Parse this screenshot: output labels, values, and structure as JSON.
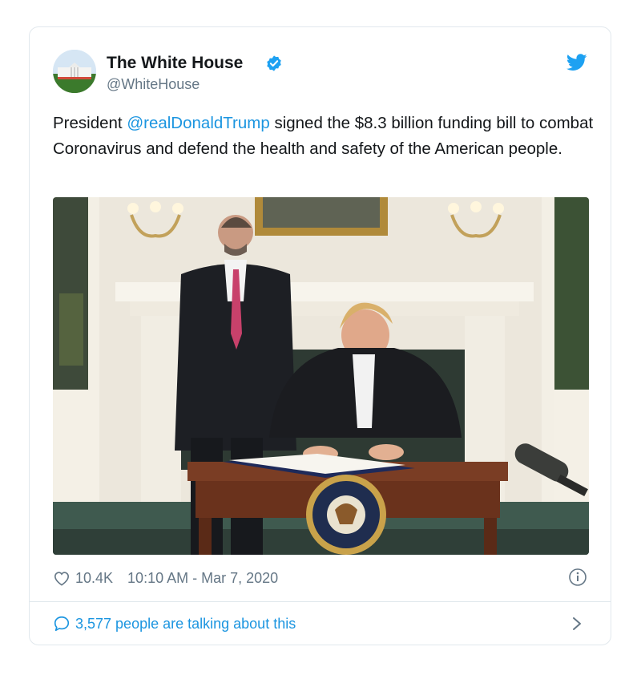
{
  "tweet": {
    "author_name": "The White House",
    "author_handle": "@WhiteHouse",
    "text_before": "President ",
    "mention": "@realDonaldTrump",
    "text_after": " signed the $8.3 billion funding bill to combat Coronavirus and defend the health and safety of the American people.",
    "likes": "10.4K",
    "timestamp": "10:10 AM - Mar 7, 2020",
    "talking": "3,577 people are talking about this"
  },
  "colors": {
    "accent": "#1da1f2",
    "link": "#1b95e0",
    "muted": "#657786"
  },
  "icons": [
    "verified-badge-icon",
    "twitter-bird-icon",
    "heart-icon",
    "info-icon",
    "comment-bubble-icon",
    "chevron-right-icon"
  ]
}
